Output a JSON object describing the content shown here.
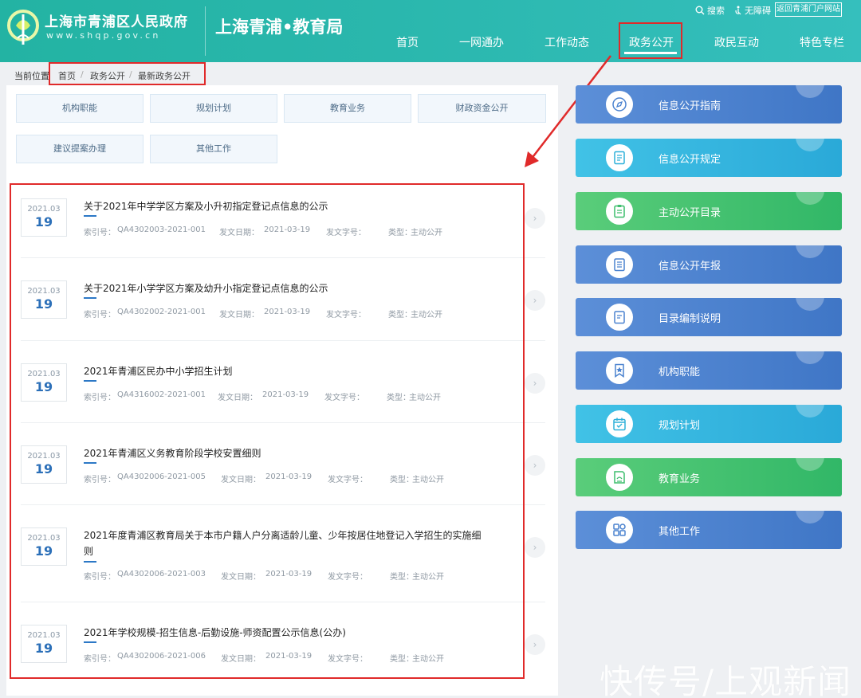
{
  "header": {
    "logo_cn": "上海市青浦区人民政府",
    "logo_url": "www.shqp.gov.cn",
    "site_title": "上海青浦•教育局",
    "util": {
      "search": "搜索",
      "accessibility": "无障碍",
      "portal": "返回青浦门户网站"
    },
    "nav": [
      "首页",
      "一网通办",
      "工作动态",
      "政务公开",
      "政民互动",
      "特色专栏"
    ]
  },
  "breadcrumb": {
    "label": "当前位置",
    "items": [
      "首页",
      "政务公开",
      "最新政务公开"
    ],
    "separator": "/"
  },
  "categories": [
    "机构职能",
    "规划计划",
    "教育业务",
    "财政资金公开",
    "建议提案办理",
    "其他工作"
  ],
  "meta_labels": {
    "index": "索引号：",
    "date": "发文日期：",
    "doc_no": "发文字号：",
    "type": "类型："
  },
  "list": [
    {
      "ym": "2021.03",
      "day": "19",
      "title": "关于2021年中学学区方案及小升初指定登记点信息的公示",
      "index": "QA4302003-2021-001",
      "date": "2021-03-19",
      "doc_no": "",
      "type": "主动公开"
    },
    {
      "ym": "2021.03",
      "day": "19",
      "title": "关于2021年小学学区方案及幼升小指定登记点信息的公示",
      "index": "QA4302002-2021-001",
      "date": "2021-03-19",
      "doc_no": "",
      "type": "主动公开"
    },
    {
      "ym": "2021.03",
      "day": "19",
      "title": "2021年青浦区民办中小学招生计划",
      "index": "QA4316002-2021-001",
      "date": "2021-03-19",
      "doc_no": "",
      "type": "主动公开"
    },
    {
      "ym": "2021.03",
      "day": "19",
      "title": "2021年青浦区义务教育阶段学校安置细则",
      "index": "QA4302006-2021-005",
      "date": "2021-03-19",
      "doc_no": "",
      "type": "主动公开"
    },
    {
      "ym": "2021.03",
      "day": "19",
      "title": "2021年度青浦区教育局关于本市户籍人户分离适龄儿童、少年按居住地登记入学招生的实施细则",
      "index": "QA4302006-2021-003",
      "date": "2021-03-19",
      "doc_no": "",
      "type": "主动公开"
    },
    {
      "ym": "2021.03",
      "day": "19",
      "title": "2021年学校规模-招生信息-后勤设施-师资配置公示信息(公办)",
      "index": "QA4302006-2021-006",
      "date": "2021-03-19",
      "doc_no": "",
      "type": "主动公开"
    }
  ],
  "sidebar": [
    {
      "label": "信息公开指南",
      "icon": "compass-icon",
      "color": "blue"
    },
    {
      "label": "信息公开规定",
      "icon": "document-icon",
      "color": "cyan"
    },
    {
      "label": "主动公开目录",
      "icon": "clipboard-icon",
      "color": "green"
    },
    {
      "label": "信息公开年报",
      "icon": "report-icon",
      "color": "blue"
    },
    {
      "label": "目录编制说明",
      "icon": "notes-icon",
      "color": "blue"
    },
    {
      "label": "机构职能",
      "icon": "star-badge-icon",
      "color": "blue"
    },
    {
      "label": "规划计划",
      "icon": "calendar-icon",
      "color": "cyan"
    },
    {
      "label": "教育业务",
      "icon": "book-icon",
      "color": "green"
    },
    {
      "label": "其他工作",
      "icon": "grid-icon",
      "color": "blue"
    }
  ],
  "watermark": "快传号/上观新闻",
  "colors": {
    "header": "#2ab7ad",
    "accent_blue": "#2b6fb8",
    "annotation_red": "#e02a2a"
  }
}
